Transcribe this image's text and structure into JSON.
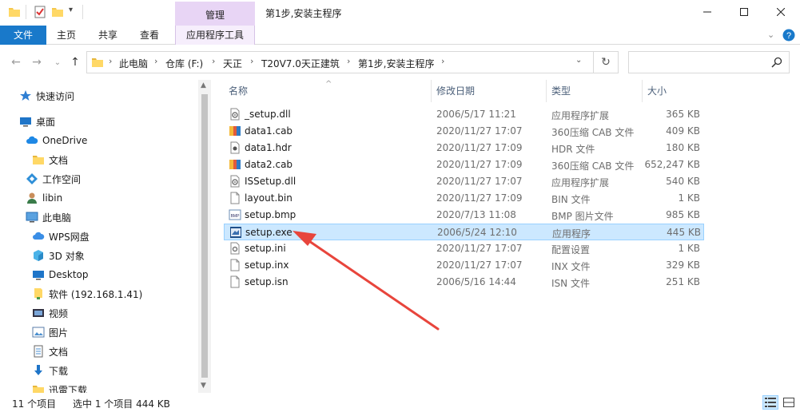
{
  "window": {
    "title": "第1步,安装主程序",
    "context_group": "管理"
  },
  "ribbon": {
    "tabs": [
      {
        "label": "文件"
      },
      {
        "label": "主页"
      },
      {
        "label": "共享"
      },
      {
        "label": "查看"
      },
      {
        "label": "应用程序工具"
      }
    ]
  },
  "address": {
    "crumbs": [
      "此电脑",
      "仓库 (F:)",
      "天正",
      "T20V7.0天正建筑",
      "第1步,安装主程序"
    ],
    "search_placeholder": ""
  },
  "nav": {
    "items": [
      {
        "label": "快速访问",
        "icon": "star-icon"
      },
      {
        "label": "桌面",
        "icon": "desktop-icon"
      },
      {
        "label": "OneDrive",
        "icon": "cloud-icon"
      },
      {
        "label": "文档",
        "icon": "folder-icon"
      },
      {
        "label": "工作空间",
        "icon": "workspace-icon"
      },
      {
        "label": "libin",
        "icon": "user-icon"
      },
      {
        "label": "此电脑",
        "icon": "computer-icon"
      },
      {
        "label": "WPS网盘",
        "icon": "wps-cloud-icon"
      },
      {
        "label": "3D 对象",
        "icon": "cube-icon"
      },
      {
        "label": "Desktop",
        "icon": "desktop-icon"
      },
      {
        "label": "软件 (192.168.1.41)",
        "icon": "network-folder-icon"
      },
      {
        "label": "视频",
        "icon": "video-icon"
      },
      {
        "label": "图片",
        "icon": "picture-icon"
      },
      {
        "label": "文档",
        "icon": "document-icon"
      },
      {
        "label": "下载",
        "icon": "download-icon"
      },
      {
        "label": "迅雷下载",
        "icon": "folder-icon"
      }
    ]
  },
  "columns": {
    "name": "名称",
    "modified": "修改日期",
    "type": "类型",
    "size": "大小"
  },
  "files": [
    {
      "name": "_setup.dll",
      "modified": "2006/5/17 11:21",
      "type": "应用程序扩展",
      "size": "365 KB",
      "icon": "dll-icon"
    },
    {
      "name": "data1.cab",
      "modified": "2020/11/27 17:07",
      "type": "360压缩 CAB 文件",
      "size": "409 KB",
      "icon": "archive-icon"
    },
    {
      "name": "data1.hdr",
      "modified": "2020/11/27 17:09",
      "type": "HDR 文件",
      "size": "180 KB",
      "icon": "hdr-icon"
    },
    {
      "name": "data2.cab",
      "modified": "2020/11/27 17:09",
      "type": "360压缩 CAB 文件",
      "size": "652,247 KB",
      "icon": "archive-icon"
    },
    {
      "name": "ISSetup.dll",
      "modified": "2020/11/27 17:07",
      "type": "应用程序扩展",
      "size": "540 KB",
      "icon": "dll-icon"
    },
    {
      "name": "layout.bin",
      "modified": "2020/11/27 17:09",
      "type": "BIN 文件",
      "size": "1 KB",
      "icon": "file-icon"
    },
    {
      "name": "setup.bmp",
      "modified": "2020/7/13 11:08",
      "type": "BMP 图片文件",
      "size": "985 KB",
      "icon": "bmp-icon"
    },
    {
      "name": "setup.exe",
      "modified": "2006/5/24 12:10",
      "type": "应用程序",
      "size": "445 KB",
      "icon": "exe-icon",
      "selected": true
    },
    {
      "name": "setup.ini",
      "modified": "2020/11/27 17:07",
      "type": "配置设置",
      "size": "1 KB",
      "icon": "ini-icon"
    },
    {
      "name": "setup.inx",
      "modified": "2020/11/27 17:07",
      "type": "INX 文件",
      "size": "329 KB",
      "icon": "file-icon"
    },
    {
      "name": "setup.isn",
      "modified": "2006/5/16 14:44",
      "type": "ISN 文件",
      "size": "251 KB",
      "icon": "file-icon"
    }
  ],
  "status": {
    "count": "11 个项目",
    "selection": "选中 1 个项目  444 KB"
  },
  "colors": {
    "file_tab": "#1979ca",
    "context_tab": "#e8d5f5",
    "selection": "#cce8ff",
    "arrow": "#e8453c"
  }
}
